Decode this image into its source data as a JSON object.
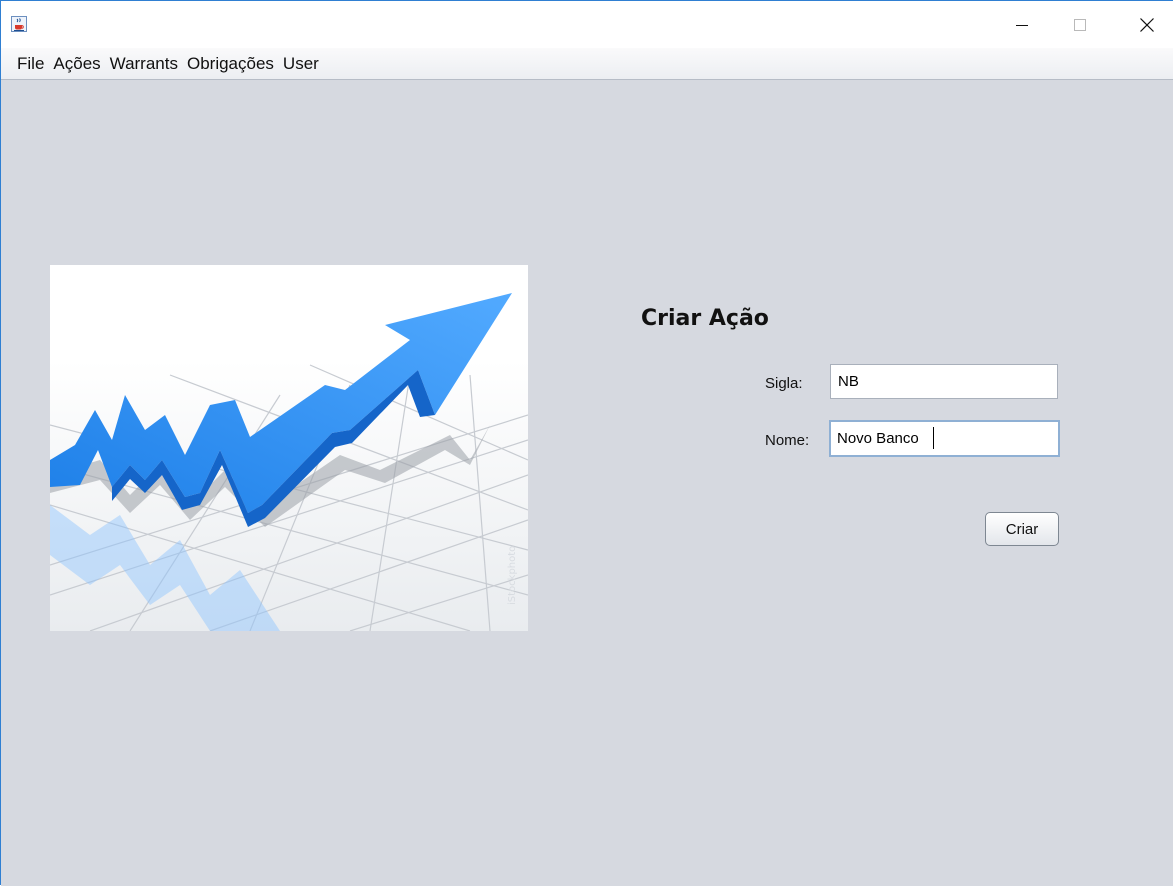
{
  "window": {
    "icon": "java-cup-icon",
    "controls": {
      "minimize": "minimize-icon",
      "maximize": "maximize-icon",
      "close": "close-icon"
    }
  },
  "menubar": {
    "items": [
      {
        "label": "File"
      },
      {
        "label": "Ações"
      },
      {
        "label": "Warrants"
      },
      {
        "label": "Obrigações"
      },
      {
        "label": "User"
      }
    ]
  },
  "form": {
    "title": "Criar Ação",
    "sigla_label": "Sigla:",
    "sigla_value": "NB",
    "nome_label": "Nome:",
    "nome_value": "Novo Banco",
    "submit_label": "Criar"
  },
  "colors": {
    "accent_border": "#2f7fd2",
    "panel_background": "#d6d9e0",
    "arrow_blue": "#2d8ff0"
  }
}
